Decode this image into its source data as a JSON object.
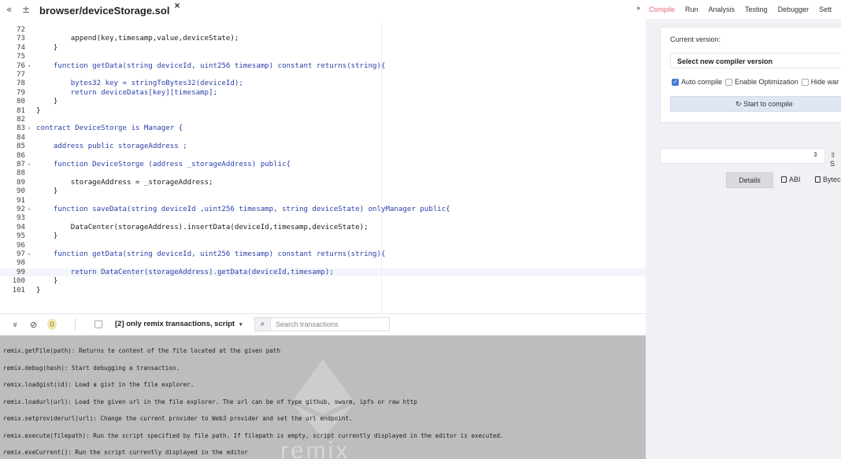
{
  "tabbar": {
    "back_glyph": "«",
    "add_glyph": "±",
    "file_tab_title": "browser/deviceStorage.sol",
    "close_glyph": "×"
  },
  "editor": {
    "lines": [
      {
        "n": "72",
        "fold": "",
        "code": ""
      },
      {
        "n": "73",
        "fold": "",
        "code": "        append(key,timesamp,value,deviceState);"
      },
      {
        "n": "74",
        "fold": "",
        "code": "    }"
      },
      {
        "n": "75",
        "fold": "",
        "code": ""
      },
      {
        "n": "76",
        "fold": "▾",
        "code": "    function getData(string deviceId, uint256 timesamp) constant returns(string){"
      },
      {
        "n": "77",
        "fold": "",
        "code": ""
      },
      {
        "n": "78",
        "fold": "",
        "code": "        bytes32 key = stringToBytes32(deviceId);"
      },
      {
        "n": "79",
        "fold": "",
        "code": "        return deviceDatas[key][timesamp];"
      },
      {
        "n": "80",
        "fold": "",
        "code": "    }"
      },
      {
        "n": "81",
        "fold": "",
        "code": "}"
      },
      {
        "n": "82",
        "fold": "",
        "code": ""
      },
      {
        "n": "83",
        "fold": "▾",
        "code": "contract DeviceStorge is Manager {"
      },
      {
        "n": "84",
        "fold": "",
        "code": ""
      },
      {
        "n": "85",
        "fold": "",
        "code": "    address public storageAddress ;"
      },
      {
        "n": "86",
        "fold": "",
        "code": ""
      },
      {
        "n": "87",
        "fold": "▾",
        "code": "    function DeviceStorge (address _storageAddress) public{"
      },
      {
        "n": "88",
        "fold": "",
        "code": ""
      },
      {
        "n": "89",
        "fold": "",
        "code": "        storageAddress = _storageAddress;"
      },
      {
        "n": "90",
        "fold": "",
        "code": "    }"
      },
      {
        "n": "91",
        "fold": "",
        "code": ""
      },
      {
        "n": "92",
        "fold": "▾",
        "code": "    function saveData(string deviceId ,uint256 timesamp, string deviceState) onlyManager public{"
      },
      {
        "n": "93",
        "fold": "",
        "code": ""
      },
      {
        "n": "94",
        "fold": "",
        "code": "        DataCenter(storageAddress).insertData(deviceId,timesamp,deviceState);"
      },
      {
        "n": "95",
        "fold": "",
        "code": "    }"
      },
      {
        "n": "96",
        "fold": "",
        "code": ""
      },
      {
        "n": "97",
        "fold": "▾",
        "code": "    function getData(string deviceId, uint256 timesamp) constant returns(string){"
      },
      {
        "n": "98",
        "fold": "",
        "code": ""
      },
      {
        "n": "99",
        "fold": "",
        "code": "        return DataCenter(storageAddress).getData(deviceId,timesamp);"
      },
      {
        "n": "100",
        "fold": "",
        "code": "    }"
      },
      {
        "n": "101",
        "fold": "",
        "code": "}"
      }
    ],
    "active_line": "99"
  },
  "terminal_bar": {
    "collapse_glyph": "»",
    "clear_glyph": "⊘",
    "pending_count": "0",
    "filter_label": "[2] only remix transactions, script",
    "filter_caret": "▾",
    "search_glyph": "⌕",
    "search_placeholder": "Search transactions"
  },
  "terminal": {
    "watermark": "remix",
    "lines": [
      "remix.getFile(path): Returns te content of the file located at the given path",
      "remix.debug(hash): Start debugging a transaction.",
      "remix.loadgist(id): Load a gist in the file explorer.",
      "remix.loadurl(url): Load the given url in the file explorer. The url can be of type github, swarm, ipfs or raw http",
      "remix.setproviderurl(url): Change the current provider to Web3 provider and set the url endpoint.",
      "remix.execute(filepath): Run the script specified by file path. If filepath is empty, script currently displayed in the editor is executed.",
      "remix.exeCurrent(): Run the script currently displayed in the editor"
    ]
  },
  "right_panel": {
    "toggle_glyph": "»",
    "tabs": [
      "Compile",
      "Run",
      "Analysis",
      "Testing",
      "Debugger",
      "Sett"
    ],
    "active_tab": "Compile",
    "current_version_label": "Current version:",
    "version_select": "Select new compiler version",
    "auto_compile_label": "Auto compile",
    "optimization_label": "Enable Optimization",
    "hide_warnings_label": "Hide war",
    "compile_button": "Start to compile",
    "compile_glyph": "↻",
    "swarm_label": "S",
    "upload_glyph": "⇧",
    "details_button": "Details",
    "abi_button": "ABI",
    "bytecode_button": "Bytec",
    "select_caret": "⇕"
  }
}
